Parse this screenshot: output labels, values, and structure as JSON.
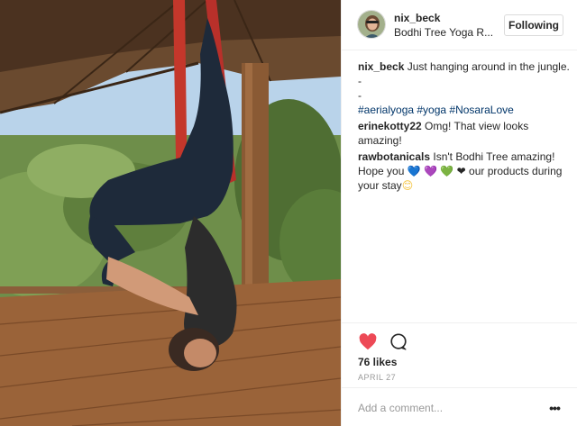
{
  "post": {
    "username": "nix_beck",
    "location": "Bodhi Tree Yoga R...",
    "follow_label": "Following",
    "photo_icon": "aerial-yoga-photo"
  },
  "caption": {
    "author": "nix_beck",
    "text": "Just hanging around in the jungle.",
    "dash1": "-",
    "dash2": "-",
    "hashtags": "#aerialyoga #yoga #NosaraLove"
  },
  "comments": [
    {
      "author": "erinekotty22",
      "text": "Omg! That view looks amazing!"
    },
    {
      "author": "rawbotanicals",
      "text_before": "Isn't Bodhi Tree amazing! Hope you",
      "emoji_blue": "💙",
      "emoji_purple": "💜",
      "emoji_green": "💚",
      "emoji_black": "❤",
      "text_after": "our products during your stay",
      "emoji_smile": "😊"
    }
  ],
  "actions": {
    "like_icon": "heart-icon",
    "comment_icon": "comment-bubble-icon",
    "likes": "76 likes",
    "date": "April 27"
  },
  "add_comment": {
    "placeholder": "Add a comment...",
    "more_icon": "more-options-icon",
    "more_glyph": "•••"
  },
  "colors": {
    "like_red": "#ed4956",
    "hashtag_blue": "#003569",
    "border": "#efefef",
    "muted": "#999999"
  }
}
